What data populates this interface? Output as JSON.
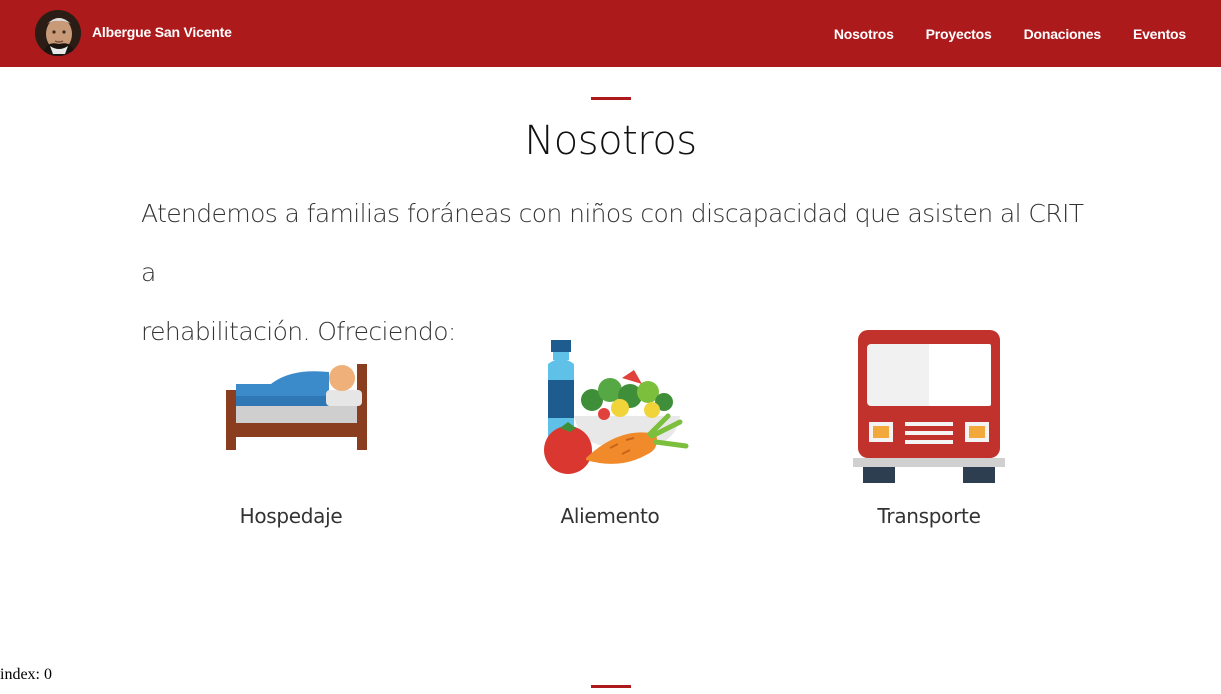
{
  "navbar": {
    "brand_name": "Albergue San Vicente",
    "links": [
      "Nosotros",
      "Proyectos",
      "Donaciones",
      "Eventos"
    ],
    "background_color": "#ad1a1c"
  },
  "about": {
    "title": "Nosotros",
    "intro_line1": "Atendemos a familias foráneas con niños con discapacidad que asisten al CRIT a",
    "intro_line2": "rehabilitación. Ofreciendo:",
    "services": [
      {
        "label": "Hospedaje",
        "icon": "bed-icon"
      },
      {
        "label": "Aliemento",
        "icon": "food-icon"
      },
      {
        "label": "Transporte",
        "icon": "bus-icon"
      }
    ]
  },
  "footer_note": "index: 0"
}
